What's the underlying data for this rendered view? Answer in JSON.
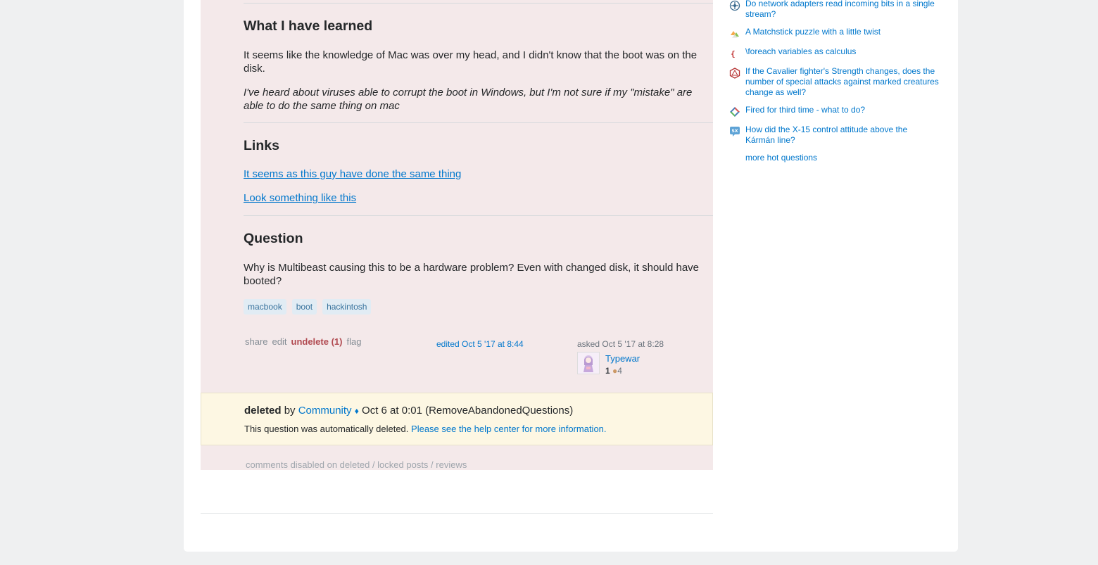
{
  "post": {
    "sections": {
      "learned": {
        "heading": "What I have learned",
        "p1": "It seems like the knowledge of Mac was over my head, and I didn't know that the boot was on the disk.",
        "p2": "I've heard about viruses able to corrupt the boot in Windows, but I'm not sure if my \"mistake\" are able to do the same thing on mac"
      },
      "links": {
        "heading": "Links",
        "link1": "It seems as this guy have done the same thing",
        "link2": "Look something like this"
      },
      "question": {
        "heading": "Question",
        "p1": "Why is Multibeast causing this to be a hardware problem? Even with changed disk, it should have booted?"
      }
    },
    "tags": [
      "macbook",
      "boot",
      "hackintosh"
    ],
    "menu": {
      "share": "share",
      "edit": "edit",
      "undelete": "undelete (1)",
      "flag": "flag"
    },
    "edited": "edited Oct 5 '17 at 8:44",
    "asked": "asked Oct 5 '17 at 8:28",
    "user": {
      "name": "Typewar",
      "rep": "1",
      "bronze": "4"
    },
    "deleted": {
      "label": "deleted",
      "by": "by",
      "user": "Community",
      "diamond": "♦",
      "when": "Oct 6 at 0:01 (RemoveAbandonedQuestions)",
      "message": "This question was automatically deleted.",
      "help_link": "Please see the help center for more information."
    },
    "comments_disabled": "comments disabled on deleted / locked posts / reviews"
  },
  "sidebar": {
    "hot_questions": [
      {
        "icon": "network-engineering-icon",
        "title": "Do network adapters read incoming bits in a single stream?"
      },
      {
        "icon": "puzzling-icon",
        "title": "A Matchstick puzzle with a little twist"
      },
      {
        "icon": "tex-icon",
        "title": "\\foreach variables as calculus"
      },
      {
        "icon": "rpg-icon",
        "title": "If the Cavalier fighter's Strength changes, does the number of special attacks against marked creatures change as well?"
      },
      {
        "icon": "workplace-icon",
        "title": "Fired for third time - what to do?"
      },
      {
        "icon": "space-exploration-icon",
        "title": "How did the X-15 control attitude above the Kármán line?"
      }
    ],
    "more": "more hot questions"
  },
  "colors": {
    "deleted_bg": "#f4e9ea",
    "notice_bg": "#fdf7e3",
    "link": "#0077cc",
    "undelete": "#b14a51"
  }
}
